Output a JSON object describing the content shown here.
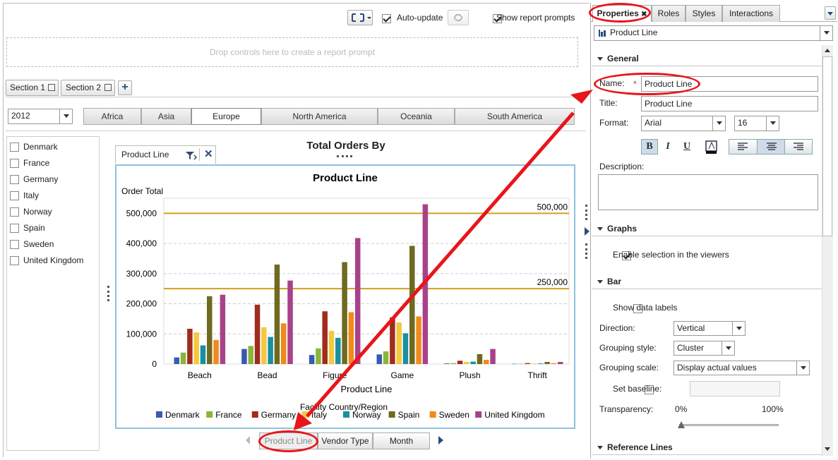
{
  "toolbar": {
    "auto_update": "Auto-update",
    "show_prompts": "Show report prompts"
  },
  "prompt_area": {
    "placeholder": "Drop controls here to create a report prompt"
  },
  "sections": [
    "Section 1",
    "Section 2"
  ],
  "year_select": {
    "value": "2012"
  },
  "region_tabs": [
    "Africa",
    "Asia",
    "Europe",
    "North America",
    "Oceania",
    "South America"
  ],
  "selected_region": "Europe",
  "countries": [
    "Denmark",
    "France",
    "Germany",
    "Italy",
    "Norway",
    "Spain",
    "Sweden",
    "United Kingdom"
  ],
  "chart_header": {
    "title": "Total Orders By",
    "tab_label": "Product Line"
  },
  "chart_data": {
    "type": "bar",
    "title": "Product Line",
    "ylabel": "Order Total",
    "xlabel": "Product Line",
    "legend_title": "Facility Country/Region",
    "categories": [
      "Beach",
      "Bead",
      "Figure",
      "Game",
      "Plush",
      "Thrift"
    ],
    "ylim": [
      0,
      550000
    ],
    "yticks": [
      "0",
      "100,000",
      "200,000",
      "300,000",
      "400,000",
      "500,000"
    ],
    "reference_lines": [
      {
        "value": 500000,
        "label": "500,000"
      },
      {
        "value": 250000,
        "label": "250,000"
      }
    ],
    "series": [
      {
        "name": "Denmark",
        "color": "#3a5ab0",
        "values": [
          22000,
          50000,
          30000,
          32000,
          2000,
          1000
        ]
      },
      {
        "name": "France",
        "color": "#8ab53a",
        "values": [
          38000,
          60000,
          52000,
          42000,
          3000,
          1000
        ]
      },
      {
        "name": "Germany",
        "color": "#a02c1e",
        "values": [
          117000,
          197000,
          175000,
          155000,
          11000,
          3000
        ]
      },
      {
        "name": "Italy",
        "color": "#f5c93f",
        "values": [
          105000,
          122000,
          110000,
          138000,
          7000,
          2000
        ]
      },
      {
        "name": "Norway",
        "color": "#1a8fa0",
        "values": [
          62000,
          90000,
          87000,
          102000,
          8000,
          2000
        ]
      },
      {
        "name": "Spain",
        "color": "#6e6a20",
        "values": [
          225000,
          330000,
          338000,
          392000,
          33000,
          7000
        ]
      },
      {
        "name": "Sweden",
        "color": "#f08a1c",
        "values": [
          80000,
          135000,
          172000,
          158000,
          14000,
          3000
        ]
      },
      {
        "name": "United Kingdom",
        "color": "#a8418a",
        "values": [
          230000,
          277000,
          418000,
          530000,
          50000,
          7000
        ]
      }
    ]
  },
  "nav_tabs": [
    "Product Line",
    "Vendor Type",
    "Month"
  ],
  "properties": {
    "tabs": [
      "Properties",
      "Roles",
      "Styles",
      "Interactions"
    ],
    "object_select": "Product Line",
    "general_header": "General",
    "name_label": "Name:",
    "name_value": "Product Line",
    "title_label": "Title:",
    "title_value": "Product Line",
    "format_label": "Format:",
    "font_value": "Arial",
    "size_value": "16",
    "bold": "B",
    "italic": "I",
    "underline": "U",
    "description_label": "Description:",
    "graphs_header": "Graphs",
    "enable_selection": "Enable selection in the viewers",
    "bar_header": "Bar",
    "show_data_labels": "Show data labels",
    "direction_label": "Direction:",
    "direction_value": "Vertical",
    "grouping_style_label": "Grouping style:",
    "grouping_style_value": "Cluster",
    "grouping_scale_label": "Grouping scale:",
    "grouping_scale_value": "Display actual values",
    "set_baseline": "Set baseline:",
    "transparency_label": "Transparency:",
    "transparency_min": "0%",
    "transparency_max": "100%",
    "transparency_value": 0,
    "reference_lines_header": "Reference Lines"
  }
}
